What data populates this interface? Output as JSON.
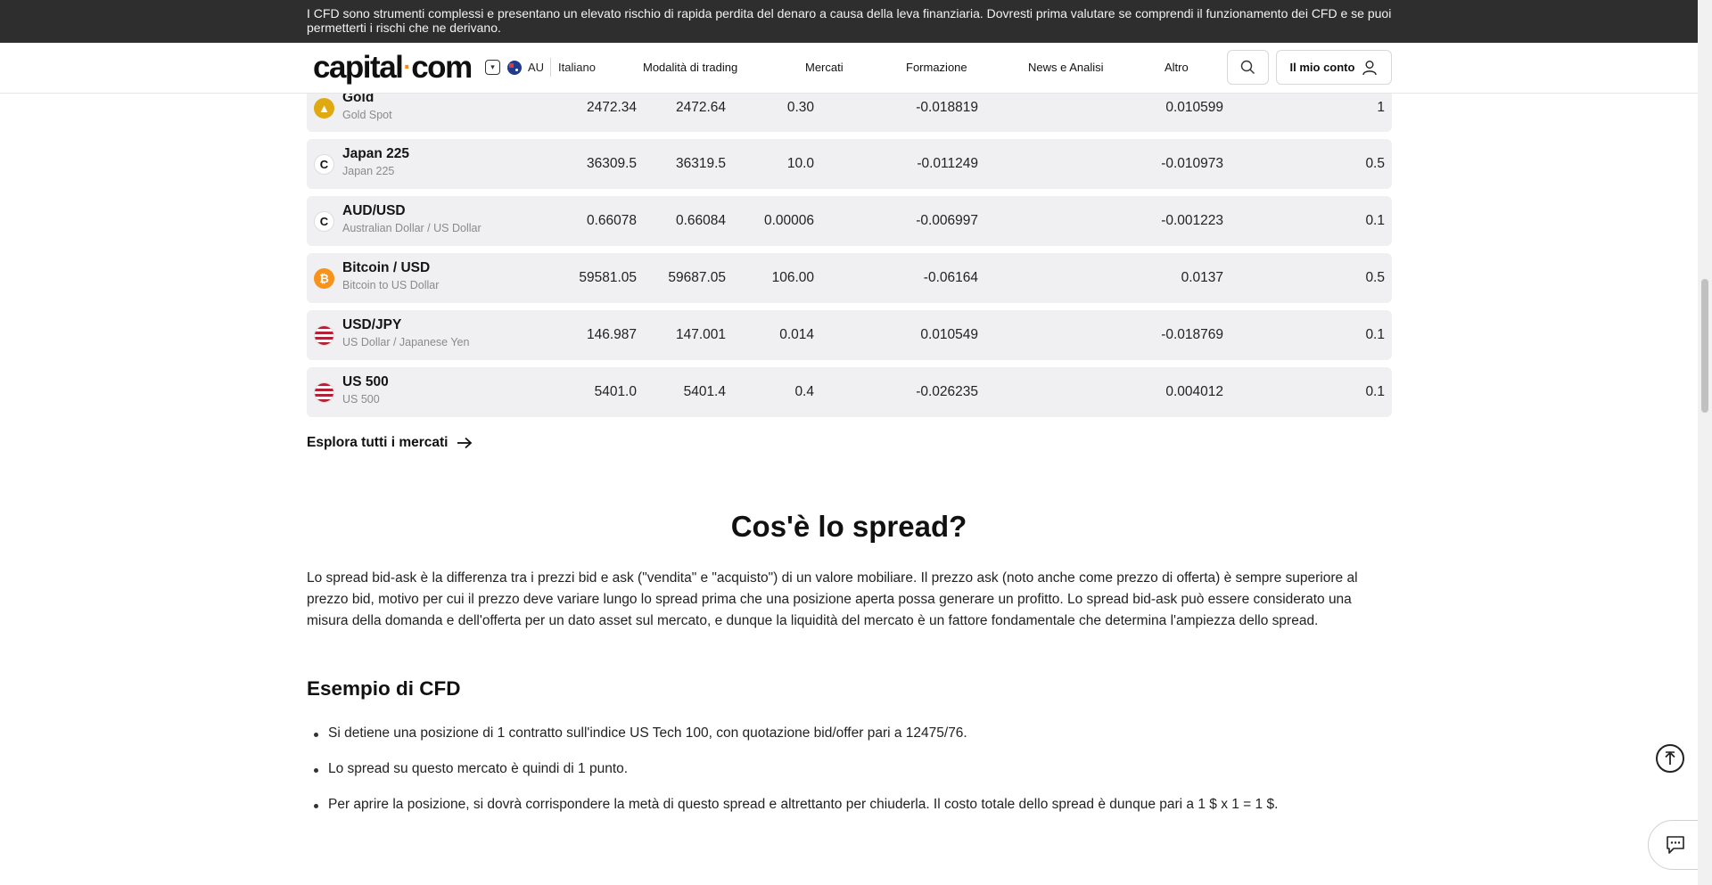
{
  "risk_banner": {
    "text": "I CFD sono strumenti complessi e presentano un elevato rischio di rapida perdita del denaro a causa della leva finanziaria. Dovresti prima valutare se comprendi il funzionamento dei CFD e se puoi permetterti i rischi che ne derivano."
  },
  "header": {
    "logo": {
      "part1": "capital",
      "dot": "·",
      "part2": "com"
    },
    "region_code": "AU",
    "language": "Italiano",
    "nav": [
      "Modalità di trading",
      "Mercati",
      "Formazione",
      "News e Analisi",
      "Altro"
    ],
    "account_label": "Il mio conto"
  },
  "markets": [
    {
      "name": "Gold",
      "sub": "Gold Spot",
      "icon": "gold-icon",
      "icon_color": "#e0a911",
      "sell": "2472.34",
      "buy": "2472.64",
      "spread": "0.30",
      "long": "-0.018819",
      "short": "0.010599",
      "margin": "1"
    },
    {
      "name": "Japan 225",
      "sub": "Japan 225",
      "icon": "capital-c-icon",
      "icon_color": "#ffffff",
      "sell": "36309.5",
      "buy": "36319.5",
      "spread": "10.0",
      "long": "-0.011249",
      "short": "-0.010973",
      "margin": "0.5"
    },
    {
      "name": "AUD/USD",
      "sub": "Australian Dollar / US Dollar",
      "icon": "capital-c-icon",
      "icon_color": "#ffffff",
      "sell": "0.66078",
      "buy": "0.66084",
      "spread": "0.00006",
      "long": "-0.006997",
      "short": "-0.001223",
      "margin": "0.1"
    },
    {
      "name": "Bitcoin / USD",
      "sub": "Bitcoin to US Dollar",
      "icon": "bitcoin-icon",
      "icon_color": "#f7931a",
      "sell": "59581.05",
      "buy": "59687.05",
      "spread": "106.00",
      "long": "-0.06164",
      "short": "0.0137",
      "margin": "0.5"
    },
    {
      "name": "USD/JPY",
      "sub": "US Dollar / Japanese Yen",
      "icon": "us-flag-icon",
      "icon_color": "#b22234",
      "sell": "146.987",
      "buy": "147.001",
      "spread": "0.014",
      "long": "0.010549",
      "short": "-0.018769",
      "margin": "0.1"
    },
    {
      "name": "US 500",
      "sub": "US 500",
      "icon": "us-flag-icon",
      "icon_color": "#b22234",
      "sell": "5401.0",
      "buy": "5401.4",
      "spread": "0.4",
      "long": "-0.026235",
      "short": "0.004012",
      "margin": "0.1"
    }
  ],
  "explore_link": "Esplora tutti i mercati",
  "spread_section": {
    "title": "Cos'è lo spread?",
    "paragraph": "Lo spread bid-ask è la differenza tra i prezzi bid e ask (\"vendita\" e \"acquisto\") di un valore mobiliare. Il prezzo ask (noto anche come prezzo di offerta) è sempre superiore al prezzo bid, motivo per cui il prezzo deve variare lungo lo spread prima che una posizione aperta possa generare un profitto. Lo spread bid-ask può essere considerato una misura della domanda e dell'offerta per un dato asset sul mercato, e dunque la liquidità del mercato è un fattore fondamentale che determina l'ampiezza dello spread."
  },
  "cfd_example": {
    "title": "Esempio di CFD",
    "bullets": [
      "Si detiene una posizione di 1 contratto sull'indice US Tech 100, con quotazione bid/offer pari a 12475/76.",
      "Lo spread su questo mercato è quindi di 1 punto.",
      "Per aprire la posizione, si dovrà corrispondere la metà di questo spread e altrettanto per chiuderla. Il costo totale dello spread è dunque pari a 1 $ x 1 = 1 $."
    ]
  },
  "colors": {
    "banner_bg": "#2e2e2e",
    "row_bg": "#f0f0f2",
    "logo_dot": "#ff8a00"
  }
}
